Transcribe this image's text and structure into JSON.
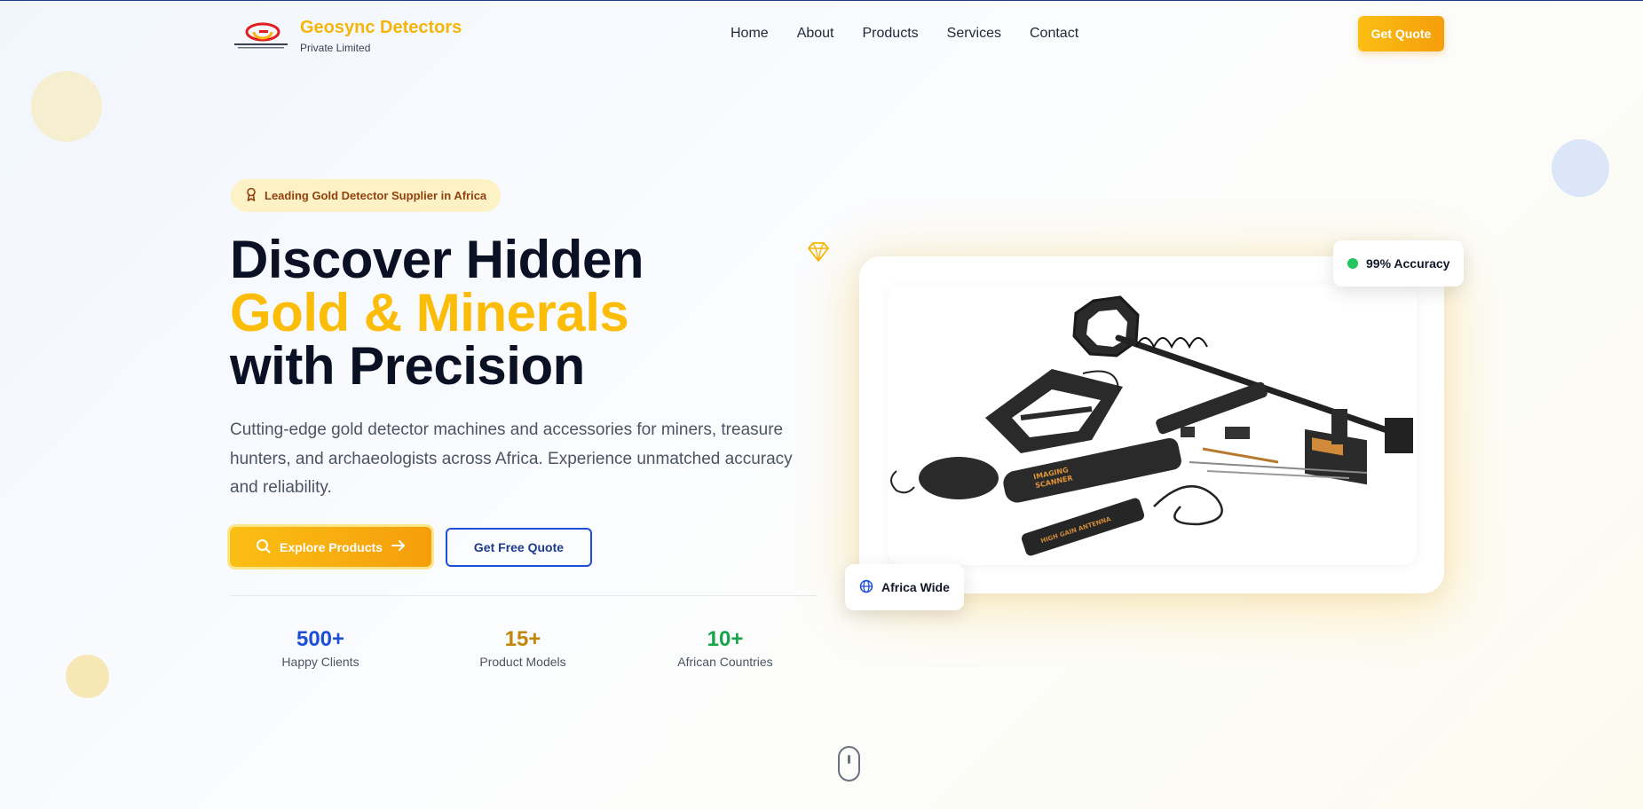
{
  "header": {
    "brand_name": "Geosync Detectors",
    "brand_sub": "Private Limited",
    "nav": [
      {
        "label": "Home"
      },
      {
        "label": "About"
      },
      {
        "label": "Products"
      },
      {
        "label": "Services"
      },
      {
        "label": "Contact"
      }
    ],
    "quote_button": "Get Quote"
  },
  "hero": {
    "badge": "Leading Gold Detector Supplier in Africa",
    "title_line1": "Discover Hidden",
    "title_line2": "Gold & Minerals",
    "title_line3": "with Precision",
    "description": "Cutting-edge gold detector machines and accessories for miners, treasure hunters, and archaeologists across Africa. Experience unmatched accuracy and reliability.",
    "explore_button": "Explore Products",
    "free_quote_button": "Get Free Quote",
    "stats": [
      {
        "value": "500+",
        "label": "Happy Clients",
        "color": "#1d4ed8"
      },
      {
        "value": "15+",
        "label": "Product Models",
        "color": "#c2860a"
      },
      {
        "value": "10+",
        "label": "African Countries",
        "color": "#16a34a"
      }
    ],
    "accuracy_badge": "99% Accuracy",
    "africa_badge": "Africa Wide"
  },
  "colors": {
    "accent_gold": "#fbbd08",
    "brand_blue": "#1d4ed8",
    "status_green": "#22c55e"
  },
  "icons": [
    "award-icon",
    "search-icon",
    "arrow-right-icon",
    "gem-icon",
    "globe-icon",
    "mouse-scroll-icon"
  ]
}
